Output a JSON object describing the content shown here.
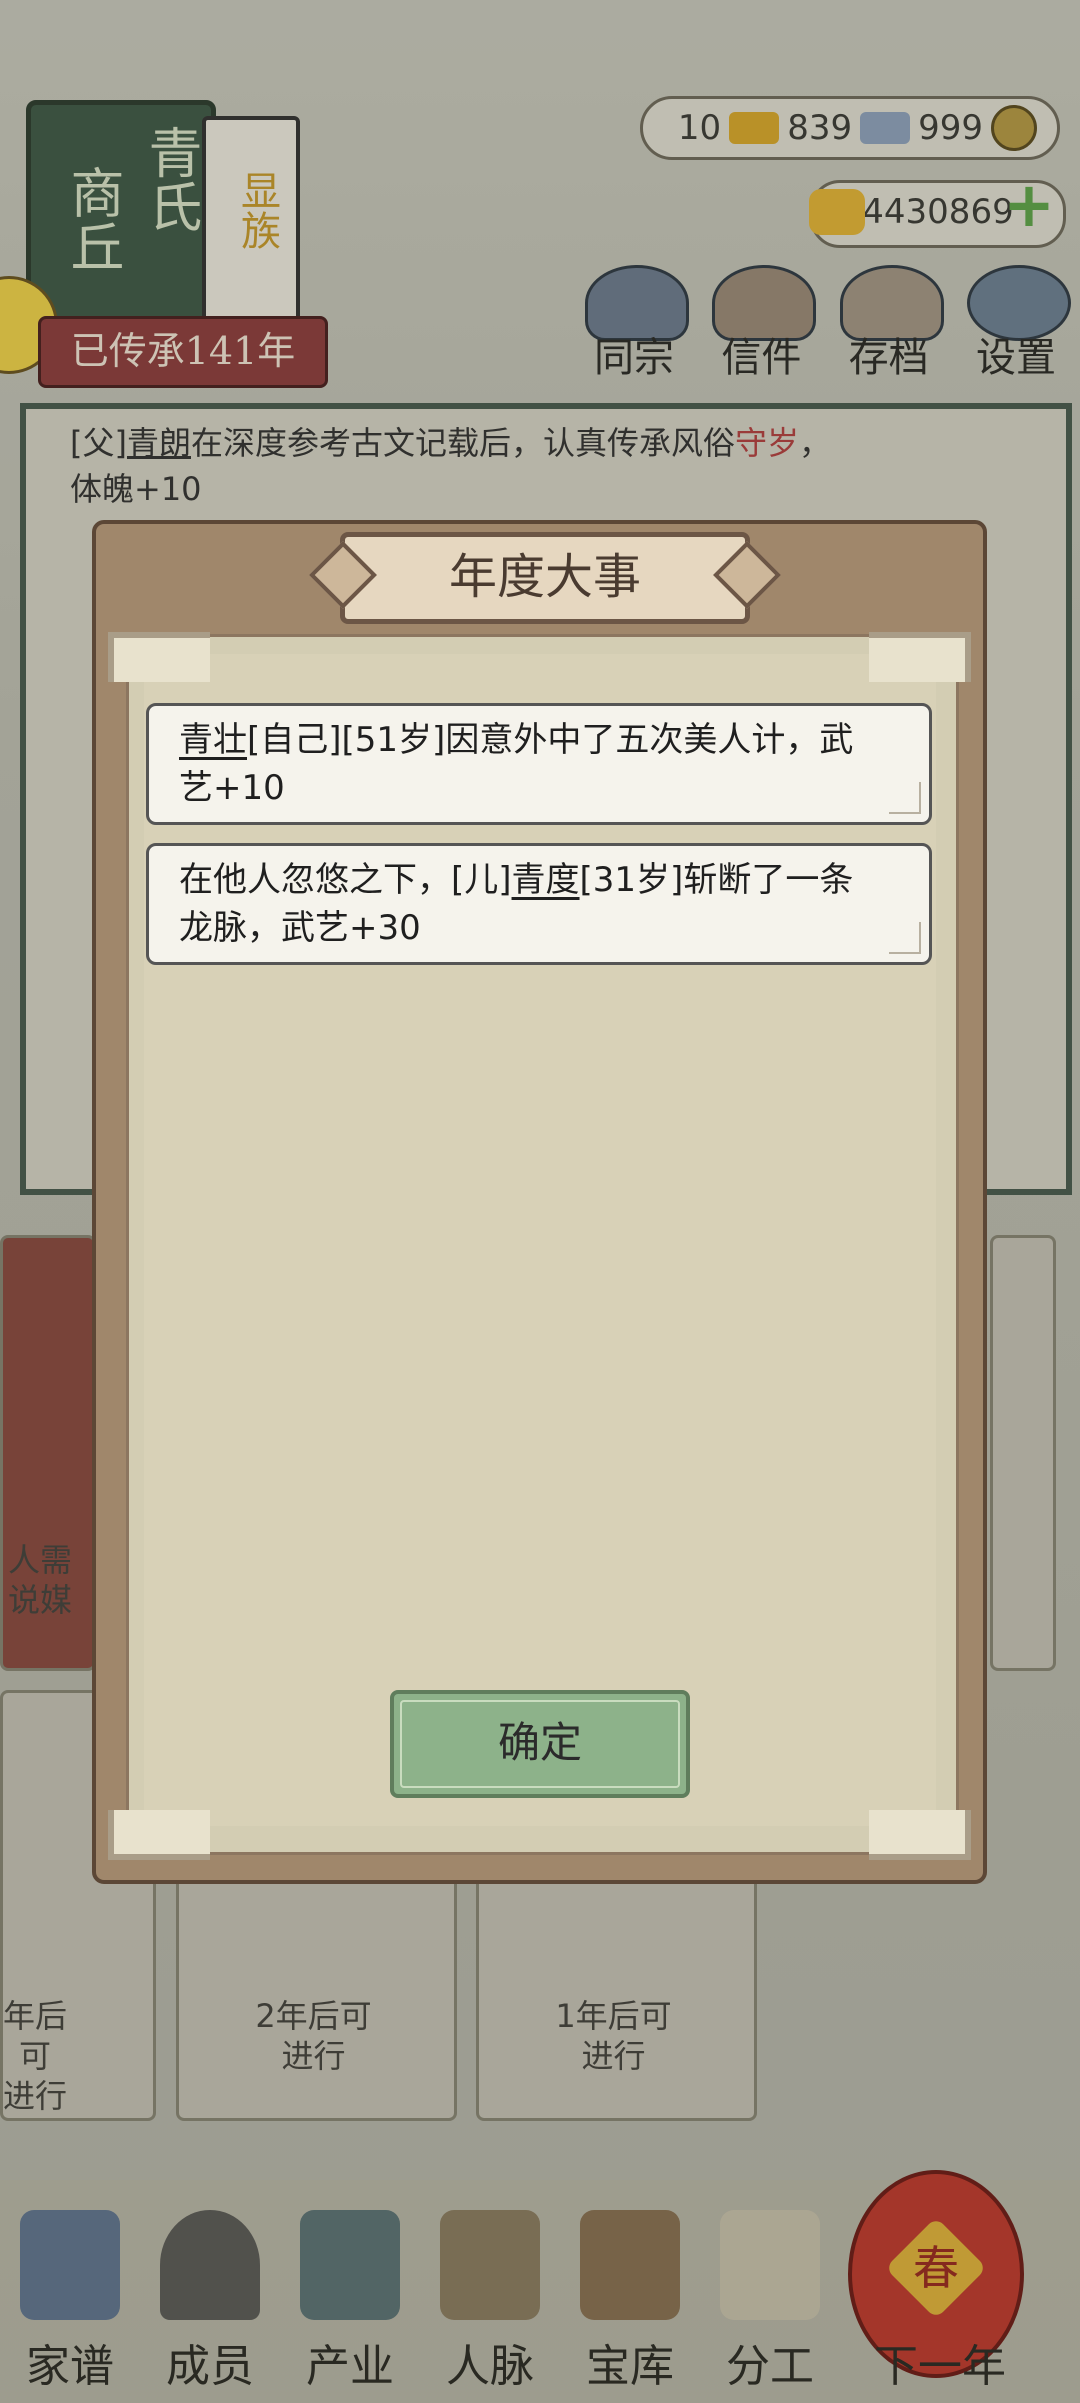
{
  "family": {
    "book_left": "商丘",
    "book_right": "青氏",
    "book_tag": "显族",
    "heritage": "已传承141年"
  },
  "currency": {
    "gold": "10",
    "silver": "839",
    "copper": "999",
    "coupons": "4430869"
  },
  "top_menu": [
    {
      "label": "同宗"
    },
    {
      "label": "信件"
    },
    {
      "label": "存档"
    },
    {
      "label": "设置"
    }
  ],
  "log": {
    "line1_prefix": "[父]",
    "line1_name": "青朗",
    "line1_mid": "在深度参考古文记载后，认真传承风俗",
    "line1_custom": "守岁",
    "line1_end": "，",
    "line2": "体魄+10"
  },
  "background_cards": {
    "left_text_1": "人需",
    "left_text_2": "说媒",
    "card1_line1": "年后可",
    "card1_line2": "进行",
    "card2_line1": "2年后可",
    "card2_line2": "进行",
    "card3_line1": "1年后可",
    "card3_line2": "进行"
  },
  "modal": {
    "title": "年度大事",
    "events": [
      {
        "name": "青壮",
        "text": "[自己][51岁]因意外中了五次美人计，武",
        "text2": "艺+10"
      },
      {
        "prefix": "在他人忽悠之下，[儿]",
        "name": "青度",
        "text": "[31岁]斩断了一条",
        "text2": "龙脉，武艺+30"
      }
    ],
    "confirm_label": "确定"
  },
  "bottom_nav": [
    {
      "label": "家谱"
    },
    {
      "label": "成员"
    },
    {
      "label": "产业"
    },
    {
      "label": "人脉"
    },
    {
      "label": "宝库"
    },
    {
      "label": "分工"
    },
    {
      "label": "下一年"
    }
  ],
  "lantern_char": "春",
  "colors": {
    "modal_frame": "#a0876b",
    "paper": "#d8d1b7",
    "confirm_green": "#8db28a",
    "heritage_red": "#8e3e3e",
    "highlight_red": "#b44040"
  }
}
